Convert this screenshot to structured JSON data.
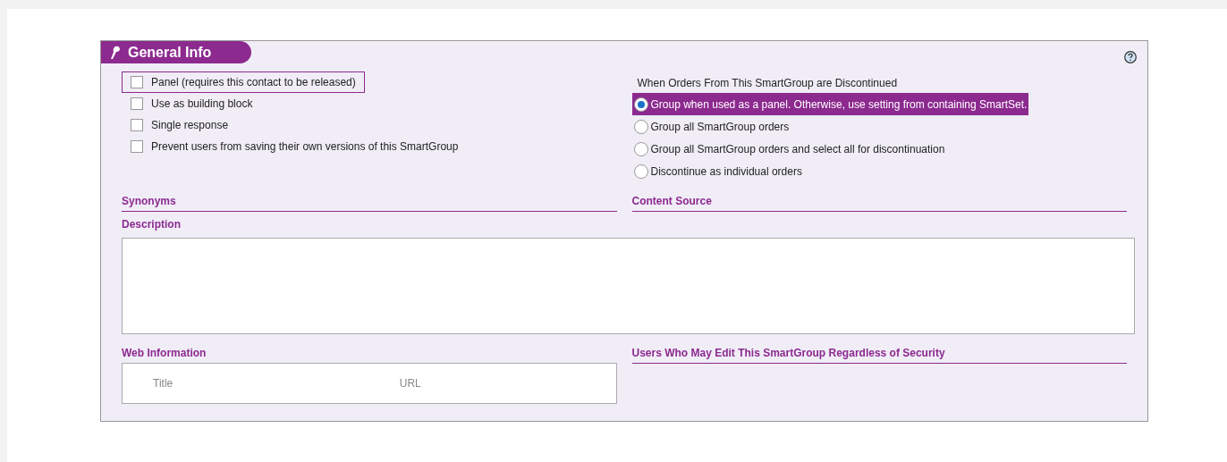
{
  "section": {
    "title": "General Info"
  },
  "options": [
    {
      "label": "Panel (requires this contact to be released)",
      "checked": false,
      "focused": true
    },
    {
      "label": "Use as building block",
      "checked": false,
      "focused": false
    },
    {
      "label": "Single response",
      "checked": false,
      "focused": false
    },
    {
      "label": "Prevent users from saving their own versions of this SmartGroup",
      "checked": false,
      "focused": false
    }
  ],
  "discontinue": {
    "heading": "When Orders From This SmartGroup are Discontinued",
    "choices": [
      {
        "label": "Group when used as a panel. Otherwise, use setting from containing SmartSet.",
        "selected": true
      },
      {
        "label": "Group all SmartGroup orders",
        "selected": false
      },
      {
        "label": "Group all SmartGroup orders and select all for discontinuation",
        "selected": false
      },
      {
        "label": "Discontinue as individual orders",
        "selected": false
      }
    ]
  },
  "synonyms": {
    "label": "Synonyms"
  },
  "content_source": {
    "label": "Content Source"
  },
  "description": {
    "label": "Description"
  },
  "web_information": {
    "label": "Web Information",
    "columns": [
      "Title",
      "URL"
    ]
  },
  "editors": {
    "label": "Users Who May Edit This SmartGroup Regardless of Security"
  }
}
